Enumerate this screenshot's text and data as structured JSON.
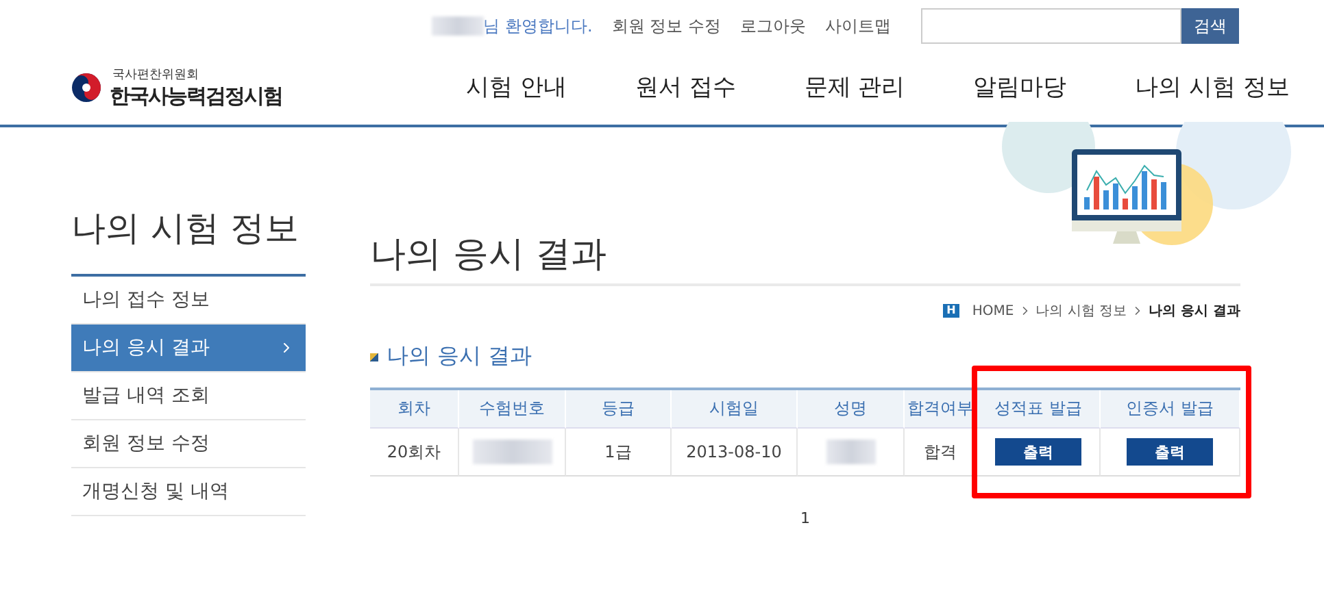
{
  "header": {
    "welcome": "님 환영합니다.",
    "links": [
      "회원 정보 수정",
      "로그아웃",
      "사이트맵"
    ],
    "search": {
      "button": "검색"
    }
  },
  "logo": {
    "org": "국사편찬위원회",
    "title": "한국사능력검정시험"
  },
  "nav": [
    "시험 안내",
    "원서 접수",
    "문제 관리",
    "알림마당",
    "나의 시험 정보"
  ],
  "sidebar": {
    "title": "나의 시험 정보",
    "items": [
      {
        "label": "나의 접수 정보",
        "selected": false
      },
      {
        "label": "나의 응시 결과",
        "selected": true
      },
      {
        "label": "발급 내역 조회",
        "selected": false
      },
      {
        "label": "회원 정보 수정",
        "selected": false
      },
      {
        "label": "개명신청 및 내역",
        "selected": false
      }
    ]
  },
  "page_title": "나의 응시 결과",
  "breadcrumb": {
    "home_mark": "H",
    "items": [
      {
        "label": "HOME",
        "current": false
      },
      {
        "label": "나의 시험 정보",
        "current": false
      },
      {
        "label": "나의 응시 결과",
        "current": true
      }
    ]
  },
  "section_title": "나의 응시 결과",
  "table": {
    "columns": [
      "회차",
      "수험번호",
      "등급",
      "시험일",
      "성명",
      "합격여부"
    ],
    "highlighted_columns": [
      "성적표 발급",
      "인증서 발급"
    ],
    "rows": [
      {
        "cells": [
          {
            "kind": "text",
            "text": "20회차"
          },
          {
            "kind": "blurred"
          },
          {
            "kind": "text",
            "text": "1급"
          },
          {
            "kind": "text",
            "text": "2013-08-10"
          },
          {
            "kind": "blurred"
          },
          {
            "kind": "text",
            "text": "합격"
          }
        ],
        "highlighted_cells": [
          {
            "kind": "button",
            "text": "출력"
          },
          {
            "kind": "button",
            "text": "출력"
          }
        ]
      }
    ]
  },
  "pagination": [
    "1"
  ]
}
